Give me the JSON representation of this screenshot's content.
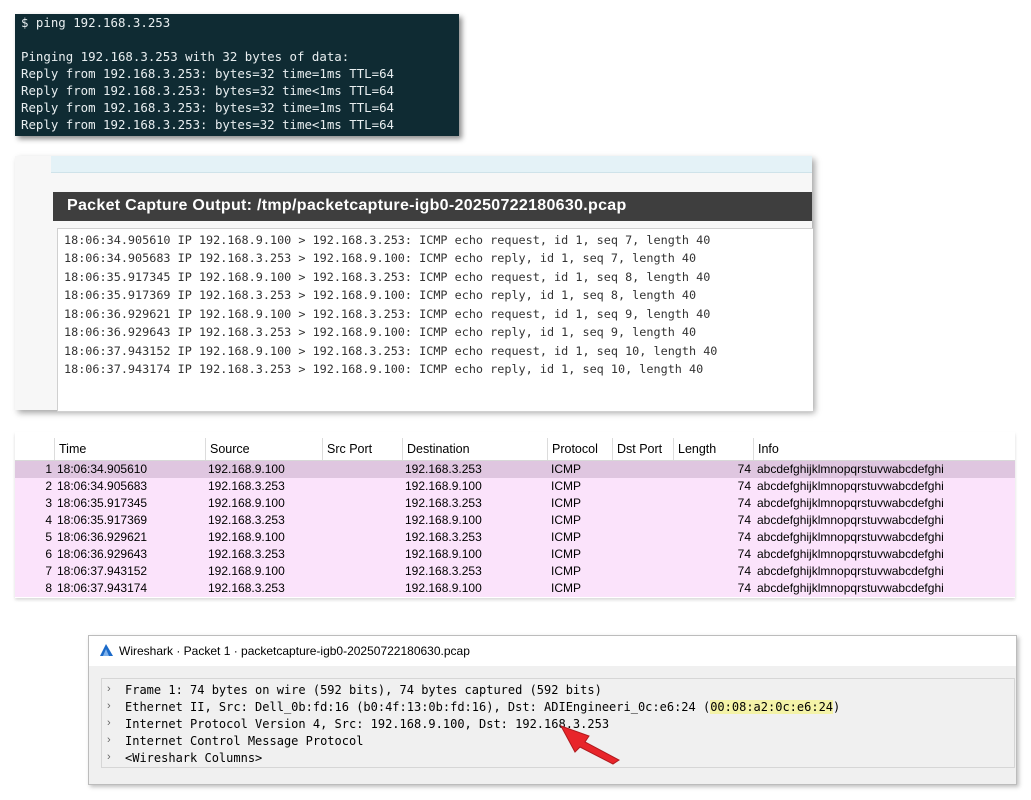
{
  "terminal": {
    "lines": [
      "$ ping 192.168.3.253",
      "",
      "Pinging 192.168.3.253 with 32 bytes of data:",
      "Reply from 192.168.3.253: bytes=32 time=1ms TTL=64",
      "Reply from 192.168.3.253: bytes=32 time<1ms TTL=64",
      "Reply from 192.168.3.253: bytes=32 time=1ms TTL=64",
      "Reply from 192.168.3.253: bytes=32 time<1ms TTL=64"
    ]
  },
  "pcap": {
    "title": "Packet Capture Output: /tmp/packetcapture-igb0-20250722180630.pcap",
    "lines": [
      "18:06:34.905610 IP 192.168.9.100 > 192.168.3.253: ICMP echo request, id 1, seq 7, length 40",
      "18:06:34.905683 IP 192.168.3.253 > 192.168.9.100: ICMP echo reply, id 1, seq 7, length 40",
      "18:06:35.917345 IP 192.168.9.100 > 192.168.3.253: ICMP echo request, id 1, seq 8, length 40",
      "18:06:35.917369 IP 192.168.3.253 > 192.168.9.100: ICMP echo reply, id 1, seq 8, length 40",
      "18:06:36.929621 IP 192.168.9.100 > 192.168.3.253: ICMP echo request, id 1, seq 9, length 40",
      "18:06:36.929643 IP 192.168.3.253 > 192.168.9.100: ICMP echo reply, id 1, seq 9, length 40",
      "18:06:37.943152 IP 192.168.9.100 > 192.168.3.253: ICMP echo request, id 1, seq 10, length 40",
      "18:06:37.943174 IP 192.168.3.253 > 192.168.9.100: ICMP echo reply, id 1, seq 10, length 40"
    ]
  },
  "packet_list": {
    "columns": [
      "Time",
      "Source",
      "Src Port",
      "Destination",
      "Protocol",
      "Dst Port",
      "Length",
      "Info"
    ],
    "rows": [
      {
        "no": "1",
        "time": "18:06:34.905610",
        "source": "192.168.9.100",
        "src_port": "",
        "destination": "192.168.3.253",
        "protocol": "ICMP",
        "dst_port": "",
        "length": "74",
        "info": "abcdefghijklmnopqrstuvwabcdefghi"
      },
      {
        "no": "2",
        "time": "18:06:34.905683",
        "source": "192.168.3.253",
        "src_port": "",
        "destination": "192.168.9.100",
        "protocol": "ICMP",
        "dst_port": "",
        "length": "74",
        "info": "abcdefghijklmnopqrstuvwabcdefghi"
      },
      {
        "no": "3",
        "time": "18:06:35.917345",
        "source": "192.168.9.100",
        "src_port": "",
        "destination": "192.168.3.253",
        "protocol": "ICMP",
        "dst_port": "",
        "length": "74",
        "info": "abcdefghijklmnopqrstuvwabcdefghi"
      },
      {
        "no": "4",
        "time": "18:06:35.917369",
        "source": "192.168.3.253",
        "src_port": "",
        "destination": "192.168.9.100",
        "protocol": "ICMP",
        "dst_port": "",
        "length": "74",
        "info": "abcdefghijklmnopqrstuvwabcdefghi"
      },
      {
        "no": "5",
        "time": "18:06:36.929621",
        "source": "192.168.9.100",
        "src_port": "",
        "destination": "192.168.3.253",
        "protocol": "ICMP",
        "dst_port": "",
        "length": "74",
        "info": "abcdefghijklmnopqrstuvwabcdefghi"
      },
      {
        "no": "6",
        "time": "18:06:36.929643",
        "source": "192.168.3.253",
        "src_port": "",
        "destination": "192.168.9.100",
        "protocol": "ICMP",
        "dst_port": "",
        "length": "74",
        "info": "abcdefghijklmnopqrstuvwabcdefghi"
      },
      {
        "no": "7",
        "time": "18:06:37.943152",
        "source": "192.168.9.100",
        "src_port": "",
        "destination": "192.168.3.253",
        "protocol": "ICMP",
        "dst_port": "",
        "length": "74",
        "info": "abcdefghijklmnopqrstuvwabcdefghi"
      },
      {
        "no": "8",
        "time": "18:06:37.943174",
        "source": "192.168.3.253",
        "src_port": "",
        "destination": "192.168.9.100",
        "protocol": "ICMP",
        "dst_port": "",
        "length": "74",
        "info": "abcdefghijklmnopqrstuvwabcdefghi"
      }
    ],
    "selected_row": 1
  },
  "detail_window": {
    "title": "Wireshark · Packet 1 · packetcapture-igb0-20250722180630.pcap",
    "icon": "wireshark-fin-icon",
    "tree": [
      {
        "text": "Frame 1: 74 bytes on wire (592 bits), 74 bytes captured (592 bits)"
      },
      {
        "text": "Ethernet II, Src: Dell_0b:fd:16 (b0:4f:13:0b:fd:16), Dst: ADIEngineeri_0c:e6:24 (",
        "highlight": "00:08:a2:0c:e6:24",
        "suffix": ")"
      },
      {
        "text": "Internet Protocol Version 4, Src: 192.168.9.100, Dst: 192.168.3.253"
      },
      {
        "text": "Internet Control Message Protocol"
      },
      {
        "text": "<Wireshark Columns>"
      }
    ],
    "expander_icon": "chevron-right-icon"
  },
  "annotation": {
    "icon": "red-arrow-icon",
    "color": "#e8252a"
  },
  "colors": {
    "terminal_bg": "#0f2b33",
    "row_bg": "#fbe3fb",
    "row_selected_bg": "#dfc6e0",
    "title_bar": "#3e3e3e",
    "mac_highlight": "#f4f3a8"
  }
}
